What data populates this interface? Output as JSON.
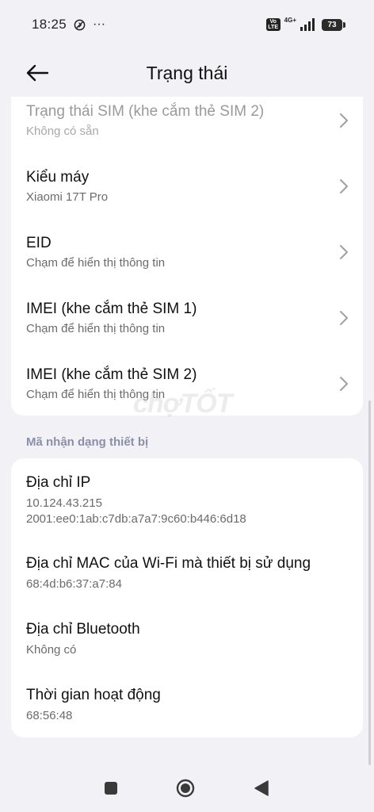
{
  "status_bar": {
    "time": "18:25",
    "more": "···",
    "volte_top": "Vo",
    "volte_bottom": "LTE",
    "network_type": "4G+",
    "battery_level": "73"
  },
  "header": {
    "title": "Trạng thái"
  },
  "info_items": [
    {
      "title": "Trạng thái SIM (khe cắm thẻ SIM 2)",
      "subtitle": "Không có sẵn"
    },
    {
      "title": "Kiểu máy",
      "subtitle": "Xiaomi 17T Pro"
    },
    {
      "title": "EID",
      "subtitle": "Chạm để hiển thị thông tin"
    },
    {
      "title": "IMEI (khe cắm thẻ SIM 1)",
      "subtitle": "Chạm để hiển thị thông tin"
    },
    {
      "title": "IMEI (khe cắm thẻ SIM 2)",
      "subtitle": "Chạm để hiển thị thông tin"
    }
  ],
  "section_header": "Mã nhận dạng thiết bị",
  "device_ids": [
    {
      "title": "Địa chỉ IP",
      "subtitle": "10.124.43.215",
      "subtitle2": "2001:ee0:1ab:c7db:a7a7:9c60:b446:6d18"
    },
    {
      "title": "Địa chỉ MAC của Wi-Fi mà thiết bị sử dụng",
      "subtitle": "68:4d:b6:37:a7:84"
    },
    {
      "title": "Địa chỉ Bluetooth",
      "subtitle": "Không có"
    },
    {
      "title": "Thời gian hoạt động",
      "subtitle": "68:56:48"
    }
  ],
  "watermark": "chợTỐT",
  "icons": {
    "back": "arrow-left-icon",
    "chevron": "chevron-right-icon",
    "nav_recents": "square-icon",
    "nav_home": "circle-icon",
    "nav_back": "triangle-left-icon"
  }
}
